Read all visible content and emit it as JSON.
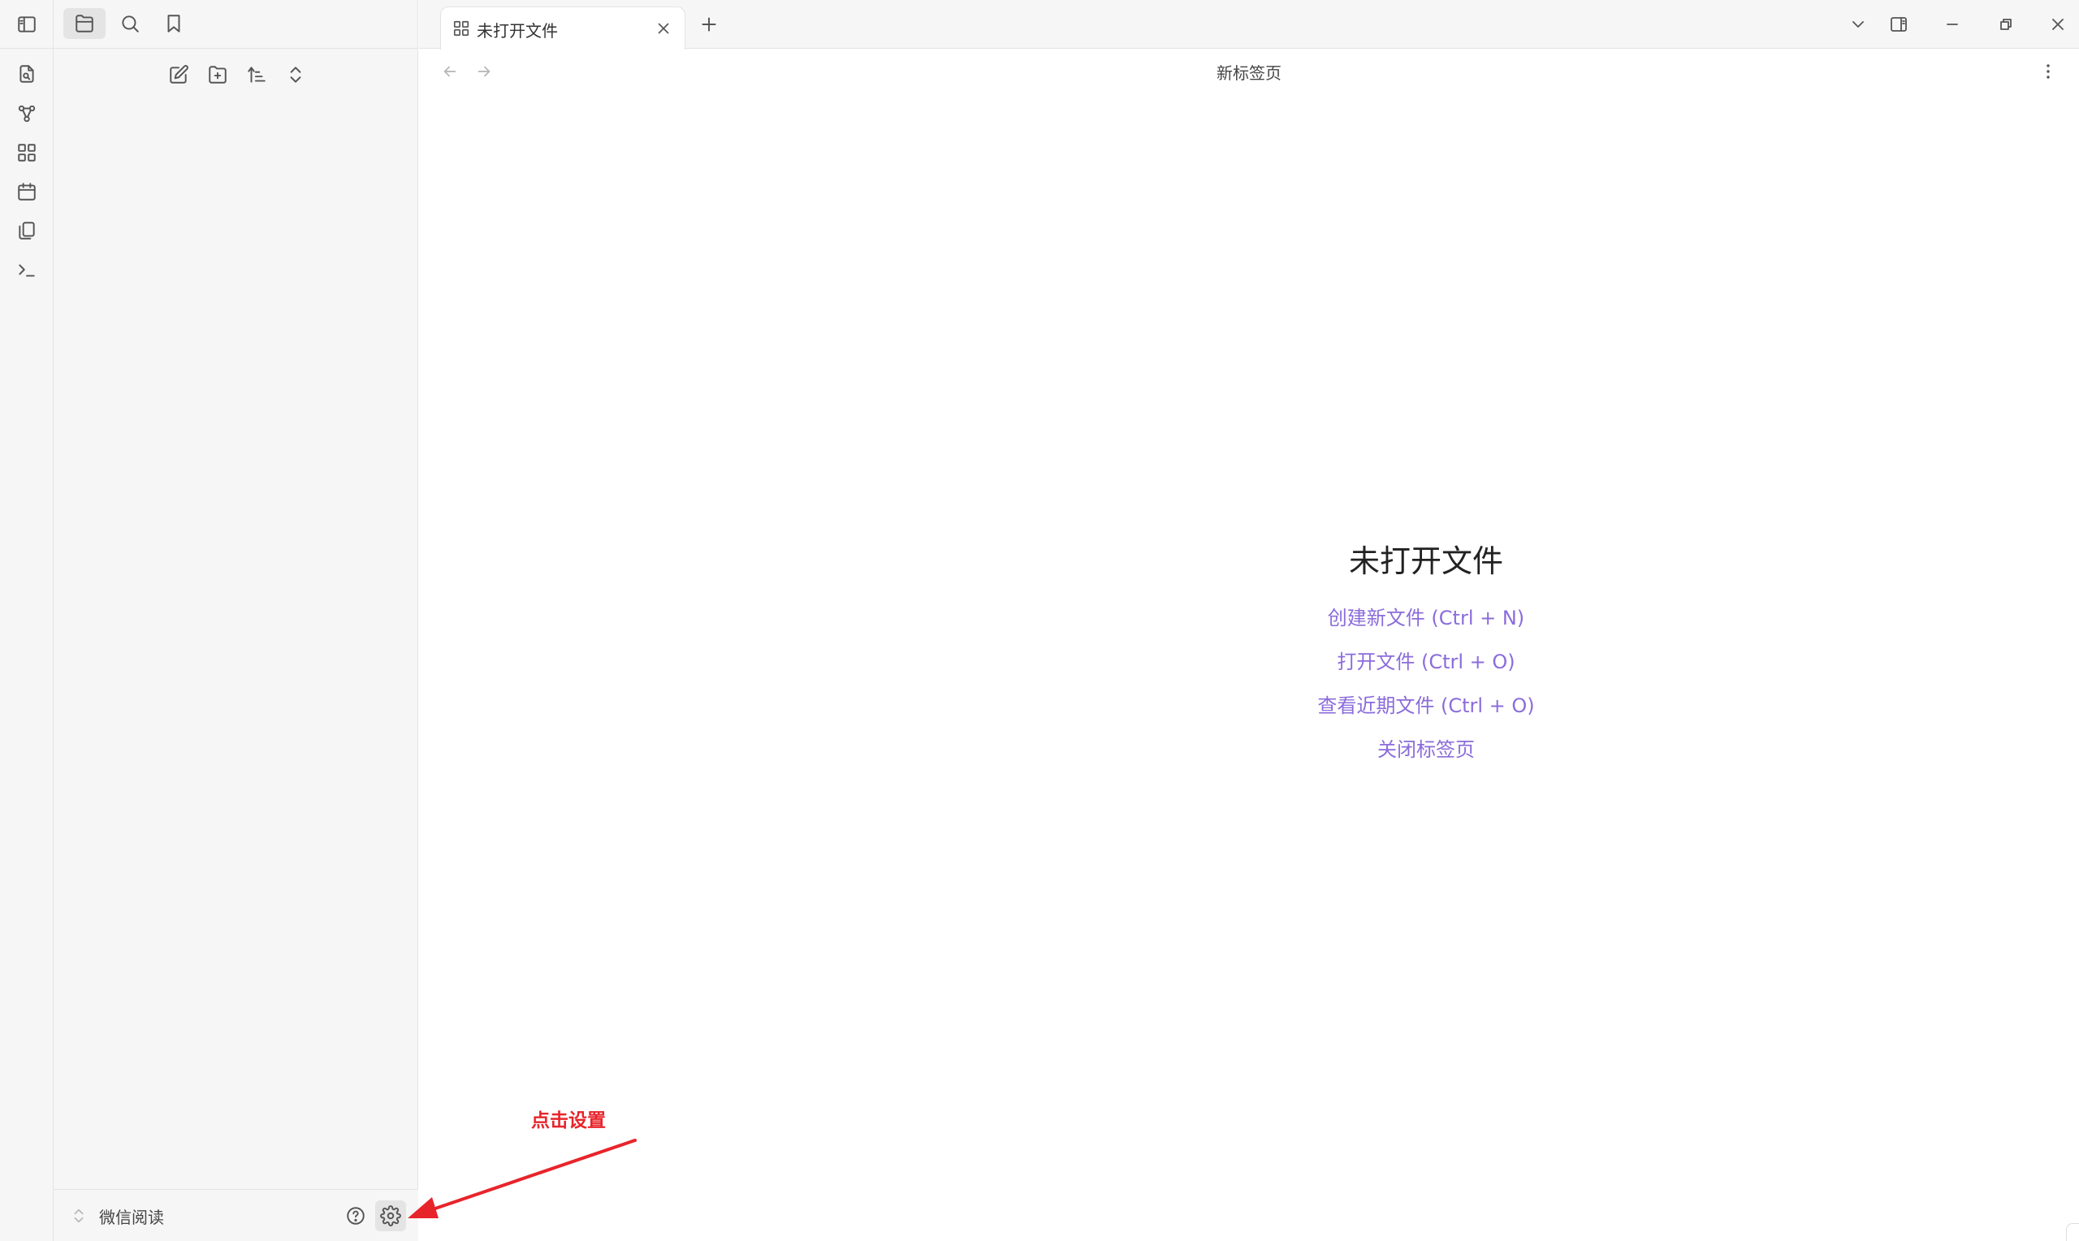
{
  "ribbon": {
    "icons": [
      {
        "name": "open-quick-switcher-icon"
      },
      {
        "name": "graph-view-icon"
      },
      {
        "name": "canvas-icon"
      },
      {
        "name": "daily-note-icon"
      },
      {
        "name": "templates-icon"
      },
      {
        "name": "command-palette-icon"
      }
    ]
  },
  "sidebar": {
    "tabs": [
      "files",
      "search",
      "bookmarks"
    ],
    "vault_name": "微信阅读"
  },
  "tab": {
    "title": "未打开文件"
  },
  "view": {
    "title": "新标签页"
  },
  "empty_state": {
    "title": "未打开文件",
    "actions": [
      "创建新文件 (Ctrl + N)",
      "打开文件 (Ctrl + O)",
      "查看近期文件 (Ctrl + O)",
      "关闭标签页"
    ]
  },
  "annotation": {
    "text": "点击设置"
  },
  "colors": {
    "accent": "#8b6cdb",
    "annotation": "#e8242b"
  }
}
